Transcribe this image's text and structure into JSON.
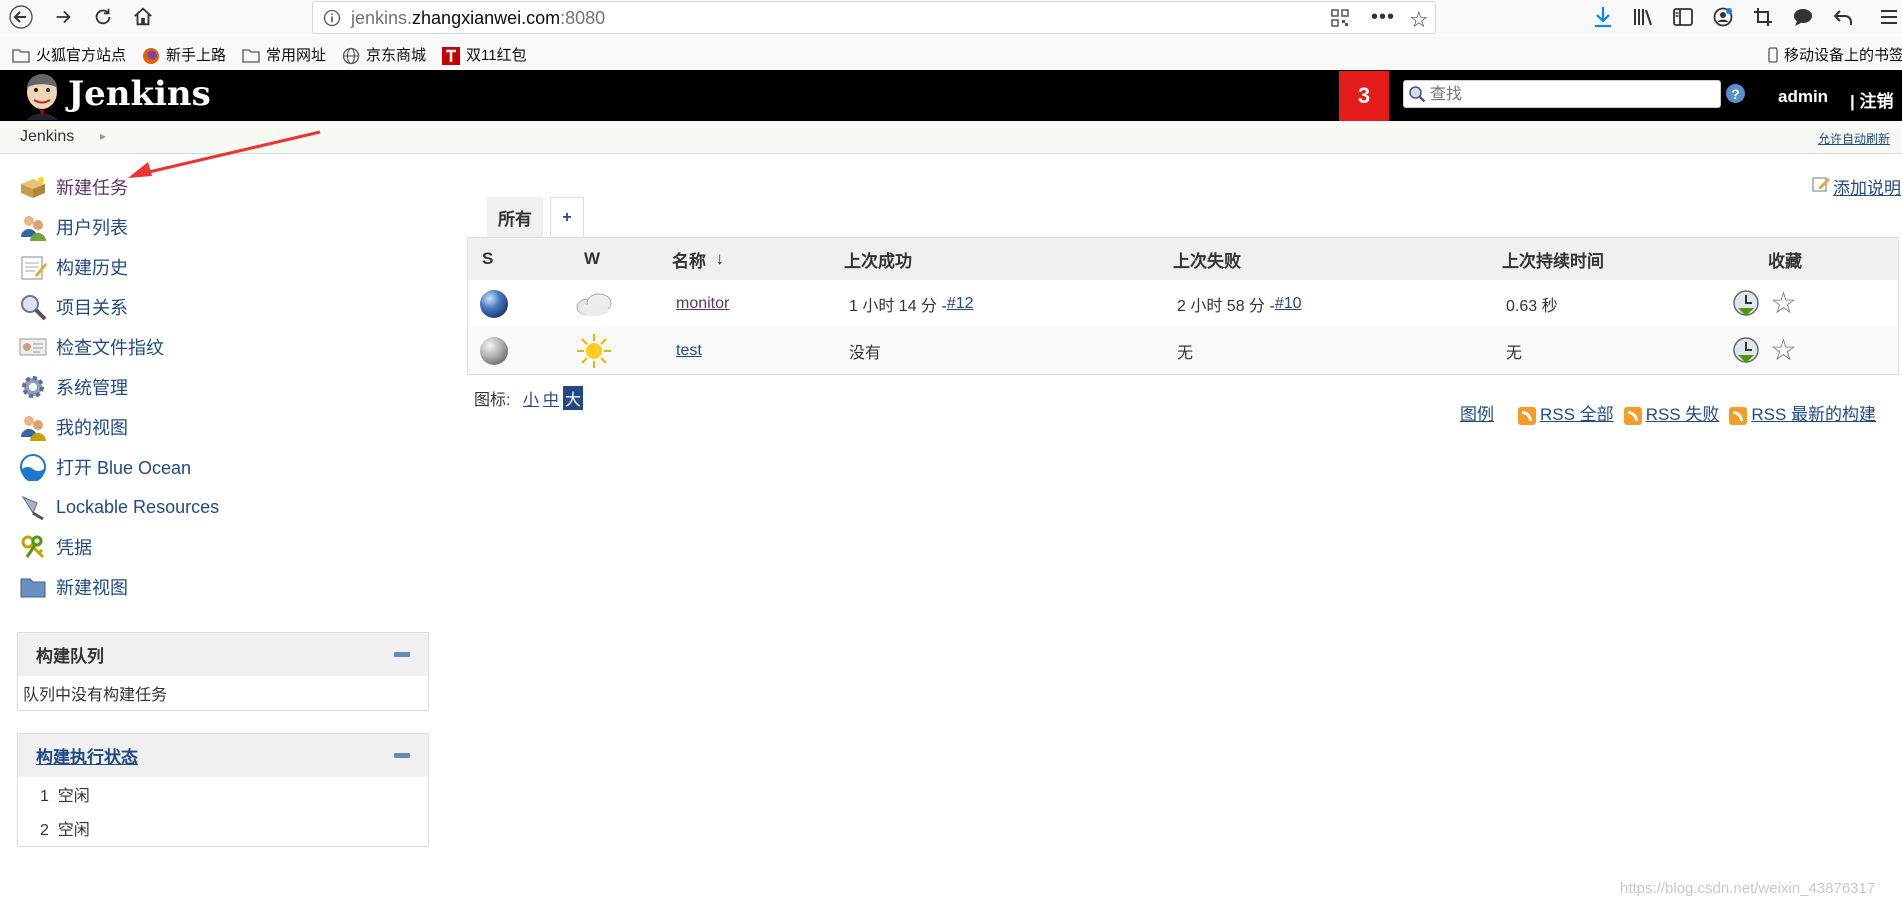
{
  "browser": {
    "url_prefix": "jenkins.",
    "url_host": "zhangxianwei.com",
    "url_port": ":8080",
    "bookmarks": [
      "火狐官方站点",
      "新手上路",
      "常用网址",
      "京东商城",
      "双11红包"
    ],
    "mobile_bookmarks": "移动设备上的书签"
  },
  "header": {
    "title": "Jenkins",
    "notification_count": "3",
    "search_placeholder": "查找",
    "help": "?",
    "user": "admin",
    "logout": "| 注销"
  },
  "breadcrumb": {
    "root": "Jenkins",
    "auto_refresh": "允许自动刷新"
  },
  "sidebar": {
    "tasks": [
      {
        "label": "新建任务",
        "icon": "new-package-icon"
      },
      {
        "label": "用户列表",
        "icon": "users-icon"
      },
      {
        "label": "构建历史",
        "icon": "notepad-icon"
      },
      {
        "label": "项目关系",
        "icon": "magnifier-icon"
      },
      {
        "label": "检查文件指纹",
        "icon": "fingerprint-icon"
      },
      {
        "label": "系统管理",
        "icon": "gear-icon"
      },
      {
        "label": "我的视图",
        "icon": "user-view-icon"
      },
      {
        "label": "打开 Blue Ocean",
        "icon": "blue-ocean-icon"
      },
      {
        "label": "Lockable Resources",
        "icon": "lock-icon"
      },
      {
        "label": "凭据",
        "icon": "keys-icon"
      },
      {
        "label": "新建视图",
        "icon": "folder-icon"
      }
    ],
    "build_queue": {
      "title": "构建队列",
      "empty": "队列中没有构建任务"
    },
    "executors": {
      "title": "构建执行状态",
      "rows": [
        {
          "num": "1",
          "status": "空闲"
        },
        {
          "num": "2",
          "status": "空闲"
        }
      ]
    }
  },
  "main": {
    "add_description": "添加说明",
    "tabs": {
      "all": "所有",
      "add": "+"
    },
    "columns": {
      "s": "S",
      "w": "W",
      "name": "名称",
      "sort": "↓",
      "last_success": "上次成功",
      "last_failure": "上次失败",
      "last_duration": "上次持续时间",
      "fav": "收藏"
    },
    "jobs": [
      {
        "name": "monitor",
        "status_color": "blue",
        "weather": "cloud",
        "last_success": "1 小时 14 分 - ",
        "last_success_link": "#12",
        "last_failure": "2 小时 58 分 - ",
        "last_failure_link": "#10",
        "duration": "0.63 秒"
      },
      {
        "name": "test",
        "status_color": "grey",
        "weather": "sun",
        "last_success": "没有",
        "last_success_link": "",
        "last_failure": "无",
        "last_failure_link": "",
        "duration": "无"
      }
    ],
    "icon_label": "图标:",
    "icon_sizes": [
      "小",
      "中",
      "大"
    ],
    "rss": {
      "legend": "图例",
      "all": "RSS 全部",
      "failed": "RSS 失败",
      "latest": "RSS 最新的构建"
    }
  },
  "watermark": "https://blog.csdn.net/weixin_43876317"
}
